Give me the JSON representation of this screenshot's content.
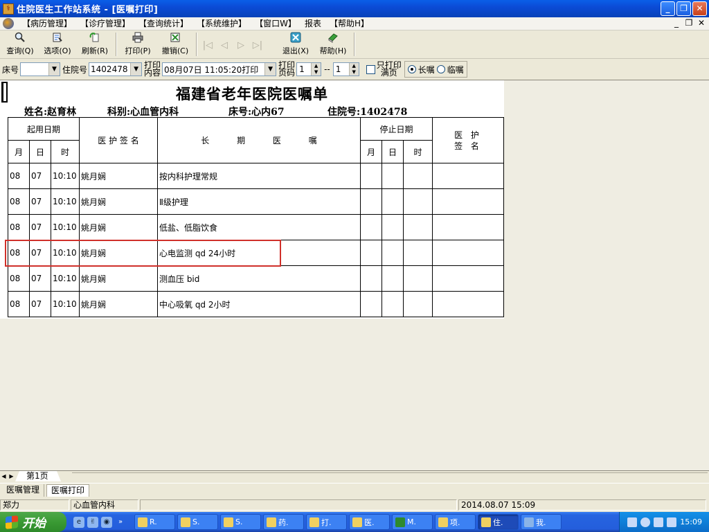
{
  "window": {
    "title": "住院医生工作站系统 - [医嘱打印]",
    "minimize": "_",
    "restore": "❐",
    "close": "✕"
  },
  "menu": {
    "items": [
      "【病历管理】",
      "【诊疗管理】",
      "【查询统计】",
      "【系统维护】",
      "【窗口W】",
      "报表",
      "【帮助H】"
    ],
    "mdi_min": "_",
    "mdi_restore": "❐",
    "mdi_close": "✕"
  },
  "toolbar": {
    "query": "查询(Q)",
    "options": "选项(O)",
    "refresh": "刷新(R)",
    "print": "打印(P)",
    "undo": "撤销(C)",
    "exit": "退出(X)",
    "help": "帮助(H)",
    "nav_first": "|◁",
    "nav_prev": "◁",
    "nav_next": "▷",
    "nav_last": "▷|"
  },
  "filters": {
    "bed_label": "床号",
    "bed_value": "",
    "inpatient_label": "住院号",
    "inpatient_value": "1402478",
    "print_content_label_1": "打印",
    "print_content_label_2": "内容",
    "print_content_value": "08月07日 11:05:20打印",
    "page_label_1": "打印",
    "page_label_2": "页码",
    "page_from": "1",
    "page_sep": "--",
    "page_to": "1",
    "only_full_label_1": "只打印",
    "only_full_label_2": "满页",
    "only_full_checked": false,
    "order_type_long": "长嘱",
    "order_type_temp": "临嘱",
    "selected_order_type": "long"
  },
  "report": {
    "title": "福建省老年医院医嘱单",
    "name_label": "姓名:",
    "name": "赵育林",
    "dept_label": "科别:",
    "dept": "心血管内科",
    "bed_label": "床号:",
    "bed": "心内67",
    "inpatient_label": "住院号:",
    "inpatient_no": "1402478",
    "headers": {
      "start_date": "起用日期",
      "month": "月",
      "day": "日",
      "time": "时",
      "nurse_sign": "医 护 签 名",
      "long_order": "长 期 医 嘱",
      "stop_date": "停止日期",
      "sign_1": "医 护",
      "sign_2": "签 名"
    },
    "rows": [
      {
        "month": "08",
        "day": "07",
        "time": "10:10",
        "signer": "姚月娴",
        "order": "按内科护理常规"
      },
      {
        "month": "08",
        "day": "07",
        "time": "10:10",
        "signer": "姚月娴",
        "order": "Ⅱ级护理"
      },
      {
        "month": "08",
        "day": "07",
        "time": "10:10",
        "signer": "姚月娴",
        "order": "低盐、低脂饮食"
      },
      {
        "month": "08",
        "day": "07",
        "time": "10:10",
        "signer": "姚月娴",
        "order": "心电监测 qd 24小时"
      },
      {
        "month": "08",
        "day": "07",
        "time": "10:10",
        "signer": "姚月娴",
        "order": "测血压 bid"
      },
      {
        "month": "08",
        "day": "07",
        "time": "10:10",
        "signer": "姚月娴",
        "order": "中心吸氧 qd 2小时"
      }
    ],
    "highlighted_row": 3
  },
  "sheet": {
    "tab": "第1页"
  },
  "mdi_tabs": [
    "医嘱管理",
    "医嘱打印"
  ],
  "status": {
    "user": "郑力",
    "dept": "心血管内科",
    "blank": "",
    "datetime": "2014.08.07 15:09"
  },
  "taskbar": {
    "start": "开始",
    "chevron": "»",
    "buttons": [
      "R.",
      "S.",
      "S.",
      "药.",
      "打.",
      "医.",
      "M.",
      "项.",
      "住.",
      "我."
    ],
    "active_index": 8,
    "clock": "15:09"
  },
  "colors": {
    "highlight_box": "#D0302A",
    "titlebar": "#0A5FE8",
    "taskbar": "#245EDC"
  }
}
